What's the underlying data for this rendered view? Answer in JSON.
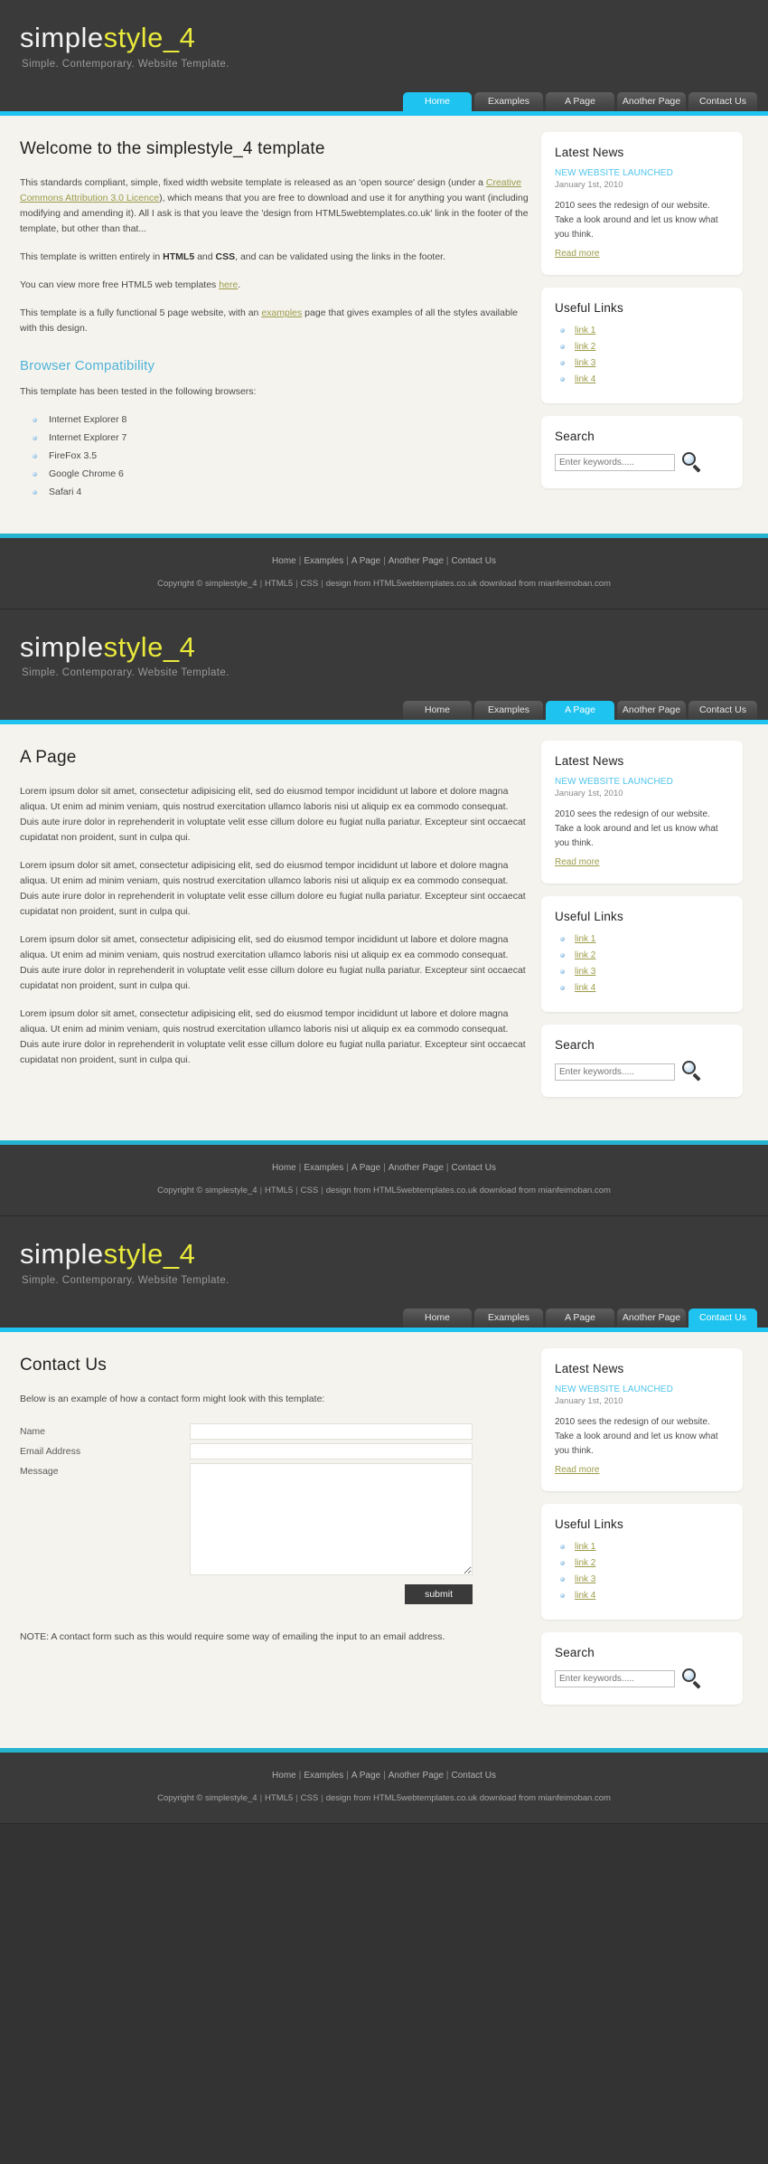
{
  "brand": {
    "part1": "simple",
    "part2": "style_4",
    "tagline": "Simple. Contemporary. Website Template.",
    "accent_yellow": "#e9e93c",
    "accent_cyan": "#1fc3f0",
    "header_bg": "#3a3a3a",
    "content_bg": "#f4f3ee",
    "link_olive": "#9c9c4a"
  },
  "nav": {
    "items": [
      {
        "label": "Home"
      },
      {
        "label": "Examples"
      },
      {
        "label": "A Page"
      },
      {
        "label": "Another Page"
      },
      {
        "label": "Contact Us"
      }
    ]
  },
  "sidebar": {
    "news": {
      "title": "Latest News",
      "headline": "NEW WEBSITE LAUNCHED",
      "date": "January 1st, 2010",
      "body": "2010 sees the redesign of our website. Take a look around and let us know what you think.",
      "read_more": "Read more"
    },
    "links": {
      "title": "Useful Links",
      "items": [
        {
          "label": "link 1"
        },
        {
          "label": "link 2"
        },
        {
          "label": "link 3"
        },
        {
          "label": "link 4"
        }
      ]
    },
    "search": {
      "title": "Search",
      "placeholder": "Enter keywords.....",
      "value": "",
      "icon": "magnifier-icon"
    }
  },
  "home": {
    "title": "Welcome to the simplestyle_4 template",
    "p1_a": "This standards compliant, simple, fixed width website template is released as an 'open source' design (under a ",
    "p1_link": "Creative Commons Attribution 3.0 Licence",
    "p1_b": "), which means that you are free to download and use it for anything you want (including modifying and amending it). All I ask is that you leave the 'design from HTML5webtemplates.co.uk' link in the footer of the template, but other than that...",
    "p2_a": "This template is written entirely in ",
    "p2_b": "HTML5",
    "p2_c": " and ",
    "p2_d": "CSS",
    "p2_e": ", and can be validated using the links in the footer.",
    "p3_a": "You can view more free HTML5 web templates ",
    "p3_link": "here",
    "p3_b": ".",
    "p4_a": "This template is a fully functional 5 page website, with an ",
    "p4_link": "examples",
    "p4_b": " page that gives examples of all the styles available with this design.",
    "subheading": "Browser Compatibility",
    "browser_intro": "This template has been tested in the following browsers:",
    "browsers": [
      {
        "label": "Internet Explorer 8"
      },
      {
        "label": "Internet Explorer 7"
      },
      {
        "label": "FireFox 3.5"
      },
      {
        "label": "Google Chrome 6"
      },
      {
        "label": "Safari 4"
      }
    ]
  },
  "apage": {
    "title": "A Page",
    "paragraph": "Lorem ipsum dolor sit amet, consectetur adipisicing elit, sed do eiusmod tempor incididunt ut labore et dolore magna aliqua. Ut enim ad minim veniam, quis nostrud exercitation ullamco laboris nisi ut aliquip ex ea commodo consequat. Duis aute irure dolor in reprehenderit in voluptate velit esse cillum dolore eu fugiat nulla pariatur. Excepteur sint occaecat cupidatat non proident, sunt in culpa qui."
  },
  "contact": {
    "title": "Contact Us",
    "intro": "Below is an example of how a contact form might look with this template:",
    "fields": [
      {
        "label": "Name",
        "value": "",
        "type": "text"
      },
      {
        "label": "Email Address",
        "value": "",
        "type": "text"
      },
      {
        "label": "Message",
        "value": "",
        "type": "textarea"
      }
    ],
    "submit_label": "submit",
    "note": "NOTE: A contact form such as this would require some way of emailing the input to an email address."
  },
  "footer": {
    "nav": [
      {
        "label": "Home"
      },
      {
        "label": "Examples"
      },
      {
        "label": "A Page"
      },
      {
        "label": "Another Page"
      },
      {
        "label": "Contact Us"
      }
    ],
    "separator": "|",
    "copy_prefix": "Copyright © simplestyle_4",
    "html5": "HTML5",
    "css": "CSS",
    "design_credit": "design from HTML5webtemplates.co.uk download from mianfeimoban.com"
  }
}
